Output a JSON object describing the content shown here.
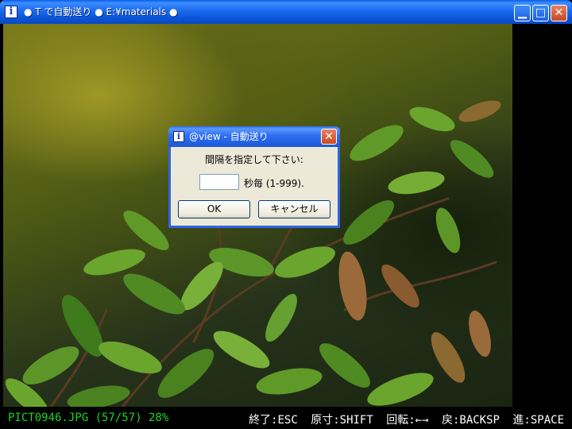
{
  "window": {
    "title": "● T で自動送り ● E:¥materials ●",
    "icon_glyph": "i",
    "controls": {
      "minimize": "▁",
      "maximize": "□",
      "close": "✕"
    }
  },
  "photo": {
    "subject": ""
  },
  "status": {
    "file_info": "PICT0946.JPG (57/57) 28%",
    "hints": [
      "終了:ESC",
      "原寸:SHIFT",
      "回転:←→",
      "戻:BACKSP",
      "進:SPACE"
    ]
  },
  "dialog": {
    "icon_glyph": "i",
    "title": "@view - 自動送り",
    "prompt": "間隔を指定して下さい:",
    "interval_value": "",
    "unit_label": "秒毎 (1-999).",
    "ok_label": "OK",
    "cancel_label": "キャンセル",
    "close_glyph": "✕"
  },
  "colors": {
    "status_file": "#1fd51f",
    "status_hints": "#ffffff",
    "titlebar": "#0b56d8"
  }
}
